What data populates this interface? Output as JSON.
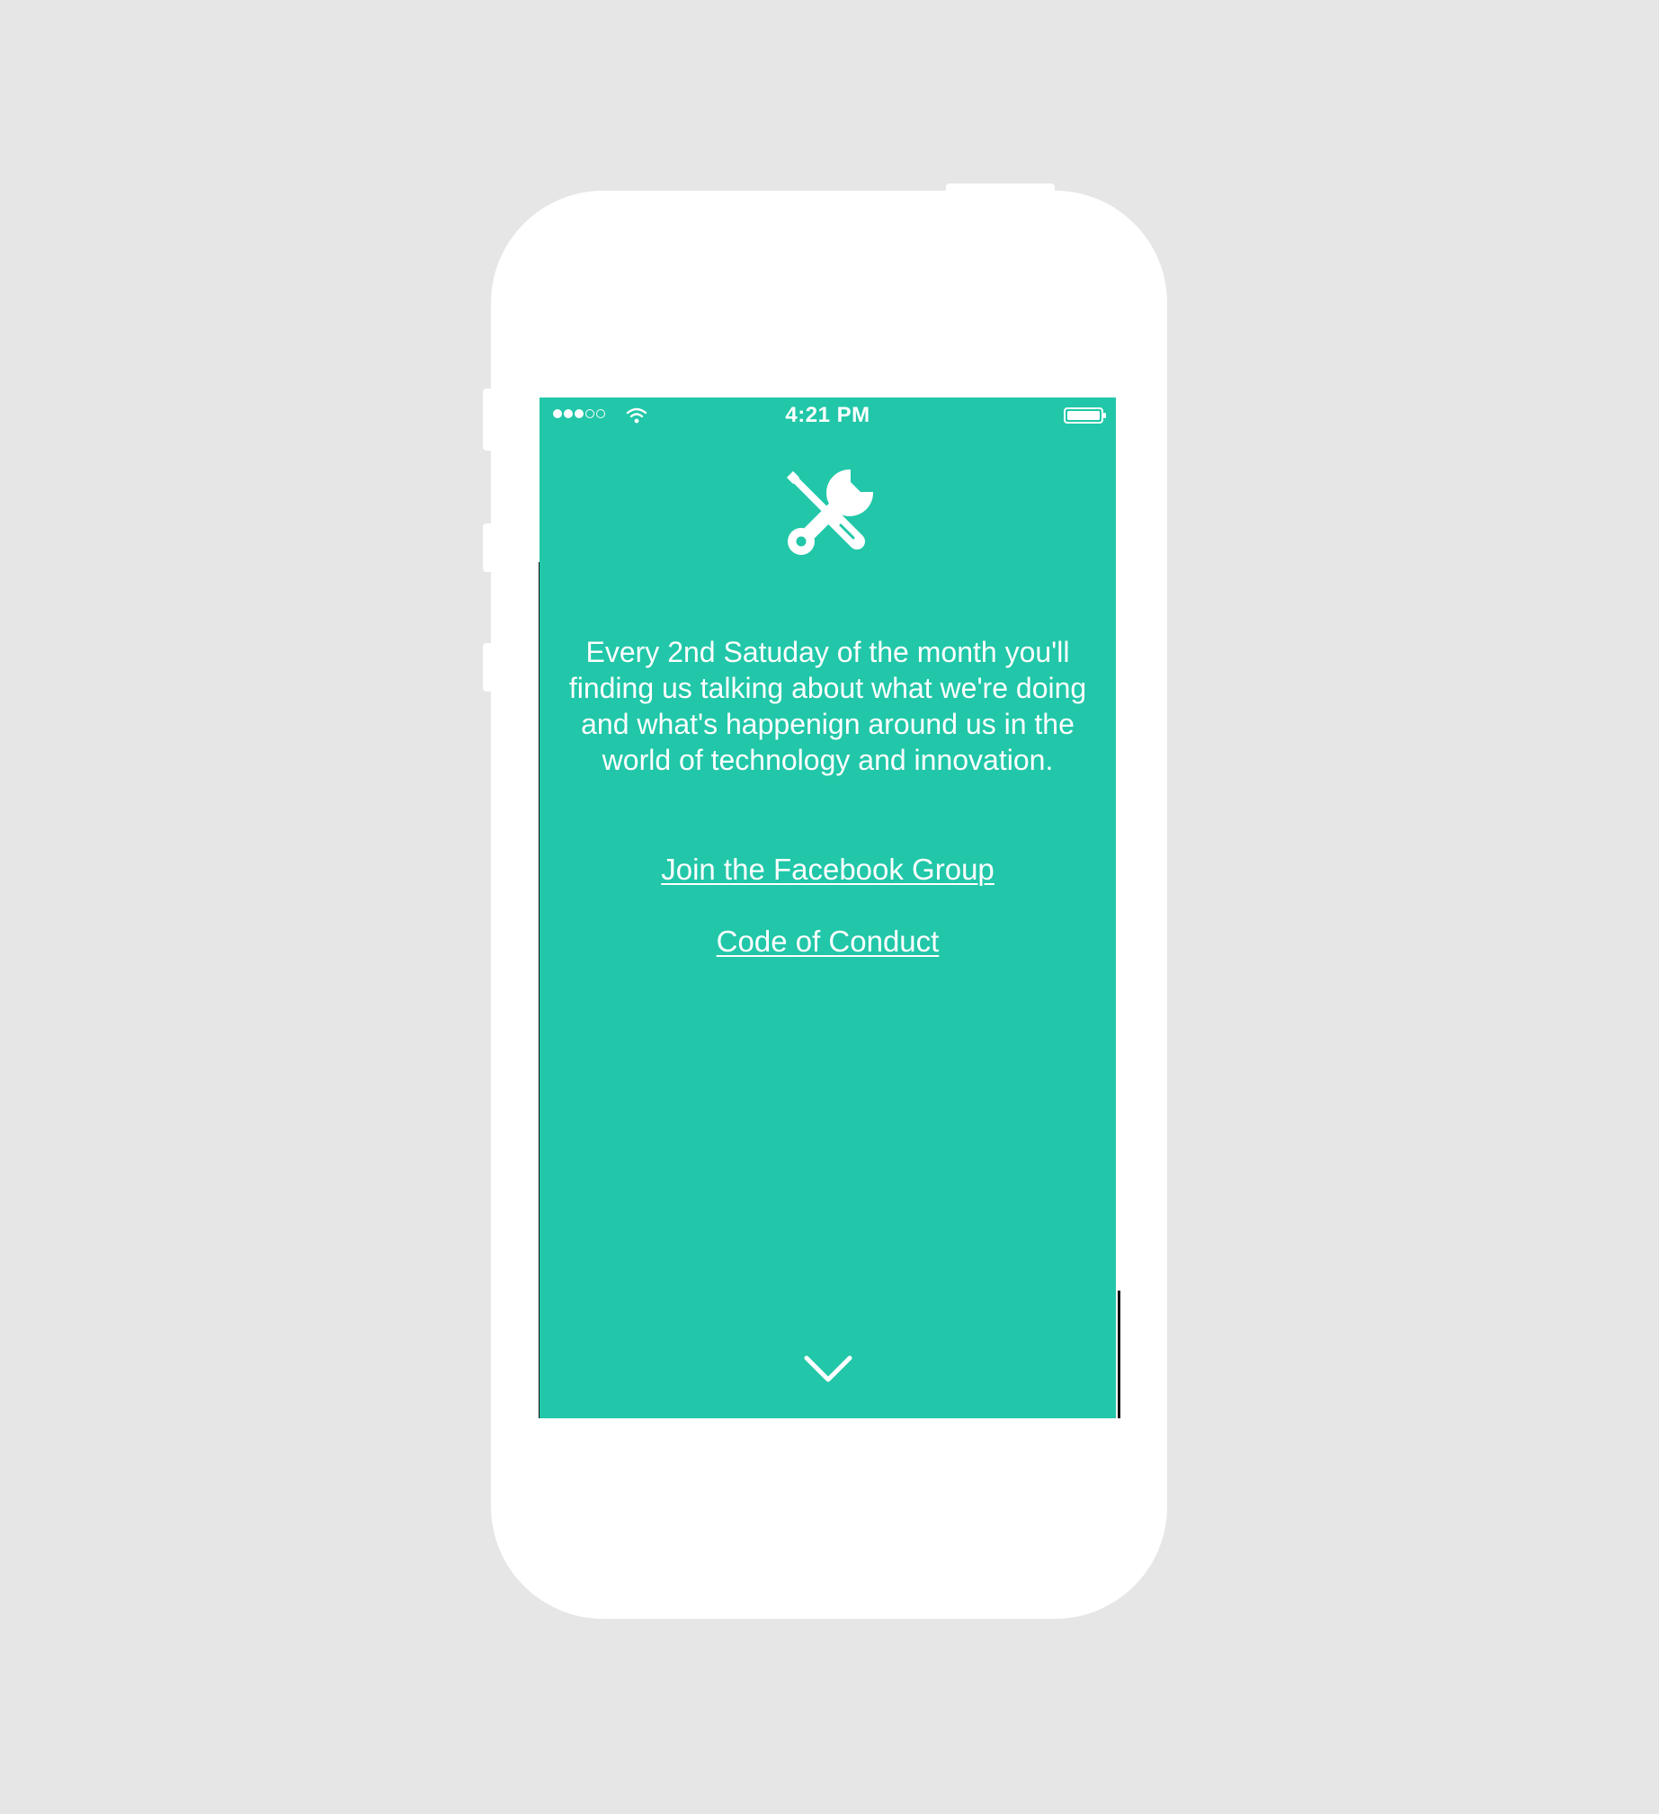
{
  "status_bar": {
    "time": "4:21 PM",
    "signal_strength_filled": 3,
    "signal_strength_total": 5,
    "wifi_icon": "wifi-icon",
    "battery_icon": "battery-icon"
  },
  "hero": {
    "icon": "tools-icon",
    "description": "Every 2nd Satuday of the month you'll finding us talking about what we're doing and what's happenign around us in the world of technology and innovation."
  },
  "links": {
    "facebook": "Join the Facebook Group",
    "code_of_conduct": "Code of Conduct"
  },
  "footer": {
    "scroll_icon": "chevron-down-icon"
  },
  "colors": {
    "background": "#e6e6e6",
    "phone_body": "#ffffff",
    "screen_accent": "#21c7a8",
    "text": "#ffffff"
  }
}
